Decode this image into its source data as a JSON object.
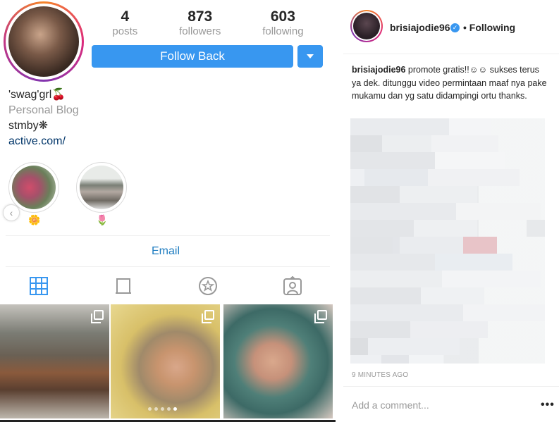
{
  "profile": {
    "stats": {
      "posts_count": "4",
      "posts_label": "posts",
      "followers_count": "873",
      "followers_label": "followers",
      "following_count": "603",
      "following_label": "following"
    },
    "follow_button": "Follow Back",
    "name": "'swag'grl🍒",
    "category": "Personal Blog",
    "bio": "stmby❋",
    "link": "active.com/",
    "highlights": [
      {
        "emoji": "🌼"
      },
      {
        "emoji": "🌷"
      }
    ],
    "email_button": "Email",
    "tabs": [
      "grid-icon",
      "tv-icon",
      "saved-icon",
      "tagged-icon"
    ]
  },
  "post": {
    "username": "brisiajodie96",
    "following_label": "• Following",
    "caption_user": "brisiajodie96",
    "caption_text": " promote gratis!!☺☺ sukses terus ya dek. ditunggu video permintaan maaf nya pake mukamu dan yg satu didampingi ortu thanks.",
    "timestamp": "9 MINUTES AGO",
    "comment_placeholder": "Add a comment...",
    "more_label": "•••"
  },
  "colors": {
    "accent": "#3897f0",
    "muted": "#999999",
    "text": "#262626"
  }
}
